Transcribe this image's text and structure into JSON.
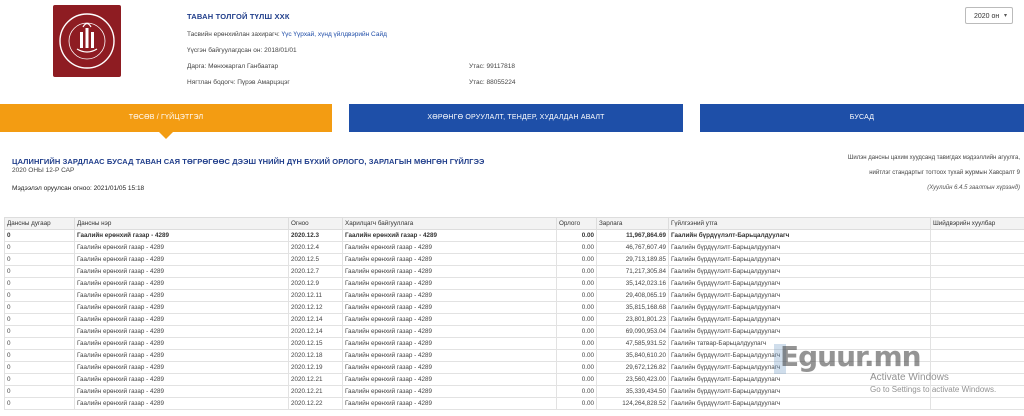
{
  "header": {
    "org_title": "ТАВАН ТОЛГОЙ ТҮЛШ ХХК",
    "logo_text": "ТАВАН ТОЛГОЙ ТҮЛШ",
    "year_select": "2020 он",
    "info": [
      {
        "label": "Тасвийн ерөнхийлан захирагч:",
        "value": "Үүс Үүрхай, хүнд үйлдвэрийн Сайд",
        "link": true
      },
      {
        "label": "Үүсгэн байгуулагдсан он:",
        "value": "2018/01/01",
        "link": false
      },
      {
        "label": "Дарга:",
        "value": "Мөнхжаргал Ганбаатар",
        "link": false
      },
      {
        "label": "Нягтлан бодогч:",
        "value": "Пүрэв Амарцэцэг",
        "link": false
      }
    ],
    "phones": [
      {
        "label": "Утас:",
        "value": "99117818"
      },
      {
        "label": "Утас:",
        "value": "88055224"
      }
    ]
  },
  "tabs": [
    {
      "label": "ТӨСӨВ / ГҮЙЦЭТГЭЛ",
      "active": true
    },
    {
      "label": "ХӨРӨНГӨ ОРУУЛАЛТ, ТЕНДЕР, ХУДАЛДАН АВАЛТ",
      "active": false
    },
    {
      "label": "БУСАД",
      "active": false
    }
  ],
  "report": {
    "title": "ЦАЛИНГИЙН ЗАРДЛААС БУСАД ТАВАН САЯ ТӨГРӨГӨӨС ДЭЭШ ҮНИЙН ДҮН БҮХИЙ ОРЛОГО, ЗАРЛАГЫН МӨНГӨН ГҮЙЛГЭЭ",
    "subtitle": "2020 ОНЫ 12-Р САР",
    "updated": "Мэдээлэл оруулсан огноо: 2021/01/05 15:18",
    "note_line1": "Шилэн дансны цахим хуудсанд тавигдах мэдээллийн агуулга,",
    "note_line2": "нийтлэг стандартыг тогтоох тухай журмын Хавсралт 9",
    "note_line3": "(Хуулийн 6.4.5 заалтын хүрээнд)"
  },
  "table": {
    "columns": [
      "Дансны дугаар",
      "Дансны нэр",
      "Огноо",
      "Харилцагч байгууллага",
      "Орлого",
      "Зарлага",
      "Гүйлгээний утга",
      "Шийдвэрийн хуулбар"
    ],
    "rows": [
      [
        "0",
        "Гаалийн ерөнхий газар - 4289",
        "2020.12.3",
        "Гаалийн ерөнхий газар - 4289",
        "0.00",
        "11,967,864.69",
        "Гаалийн бүрдүүлэлт-Барьцалдуулагч",
        ""
      ],
      [
        "0",
        "Гаалийн ерөнхий газар - 4289",
        "2020.12.4",
        "Гаалийн ерөнхий газар - 4289",
        "0.00",
        "46,767,607.49",
        "Гаалийн бүрдүүлэлт-Барьцалдуулагч",
        ""
      ],
      [
        "0",
        "Гаалийн ерөнхий газар - 4289",
        "2020.12.5",
        "Гаалийн ерөнхий газар - 4289",
        "0.00",
        "29,713,189.85",
        "Гаалийн бүрдүүлэлт-Барьцалдуулагч",
        ""
      ],
      [
        "0",
        "Гаалийн ерөнхий газар - 4289",
        "2020.12.7",
        "Гаалийн ерөнхий газар - 4289",
        "0.00",
        "71,217,305.84",
        "Гаалийн бүрдүүлэлт-Барьцалдуулагч",
        ""
      ],
      [
        "0",
        "Гаалийн ерөнхий газар - 4289",
        "2020.12.9",
        "Гаалийн ерөнхий газар - 4289",
        "0.00",
        "35,142,023.16",
        "Гаалийн бүрдүүлэлт-Барьцалдуулагч",
        ""
      ],
      [
        "0",
        "Гаалийн ерөнхий газар - 4289",
        "2020.12.11",
        "Гаалийн ерөнхий газар - 4289",
        "0.00",
        "29,408,065.19",
        "Гаалийн бүрдүүлэлт-Барьцалдуулагч",
        ""
      ],
      [
        "0",
        "Гаалийн ерөнхий газар - 4289",
        "2020.12.12",
        "Гаалийн ерөнхий газар - 4289",
        "0.00",
        "35,815,168.68",
        "Гаалийн бүрдүүлэлт-Барьцалдуулагч",
        ""
      ],
      [
        "0",
        "Гаалийн ерөнхий газар - 4289",
        "2020.12.14",
        "Гаалийн ерөнхий газар - 4289",
        "0.00",
        "23,801,801.23",
        "Гаалийн бүрдүүлэлт-Барьцалдуулагч",
        ""
      ],
      [
        "0",
        "Гаалийн ерөнхий газар - 4289",
        "2020.12.14",
        "Гаалийн ерөнхий газар - 4289",
        "0.00",
        "69,090,953.04",
        "Гаалийн бүрдүүлэлт-Барьцалдуулагч",
        ""
      ],
      [
        "0",
        "Гаалийн ерөнхий газар - 4289",
        "2020.12.15",
        "Гаалийн ерөнхий газар - 4289",
        "0.00",
        "47,585,931.52",
        "Гаалийн татвар-Барьцалдуулагч",
        ""
      ],
      [
        "0",
        "Гаалийн ерөнхий газар - 4289",
        "2020.12.18",
        "Гаалийн ерөнхий газар - 4289",
        "0.00",
        "35,840,610.20",
        "Гаалийн бүрдүүлэлт-Барьцалдуулагч",
        ""
      ],
      [
        "0",
        "Гаалийн ерөнхий газар - 4289",
        "2020.12.19",
        "Гаалийн ерөнхий газар - 4289",
        "0.00",
        "29,672,126.82",
        "Гаалийн бүрдүүлэлт-Барьцалдуулагч",
        ""
      ],
      [
        "0",
        "Гаалийн ерөнхий газар - 4289",
        "2020.12.21",
        "Гаалийн ерөнхий газар - 4289",
        "0.00",
        "23,560,423.00",
        "Гаалийн бүрдүүлэлт-Барьцалдуулагч",
        ""
      ],
      [
        "0",
        "Гаалийн ерөнхий газар - 4289",
        "2020.12.21",
        "Гаалийн ерөнхий газар - 4289",
        "0.00",
        "35,339,434.50",
        "Гаалийн бүрдүүлэлт-Барьцалдуулагч",
        ""
      ],
      [
        "0",
        "Гаалийн ерөнхий газар - 4289",
        "2020.12.22",
        "Гаалийн ерөнхий газар - 4289",
        "0.00",
        "124,264,828.52",
        "Гаалийн бүрдүүлэлт-Барьцалдуулагч",
        ""
      ]
    ]
  },
  "overlay": {
    "watermark": "Eguur.mn",
    "activate_title": "Activate Windows",
    "activate_sub": "Go to Settings to activate Windows."
  }
}
